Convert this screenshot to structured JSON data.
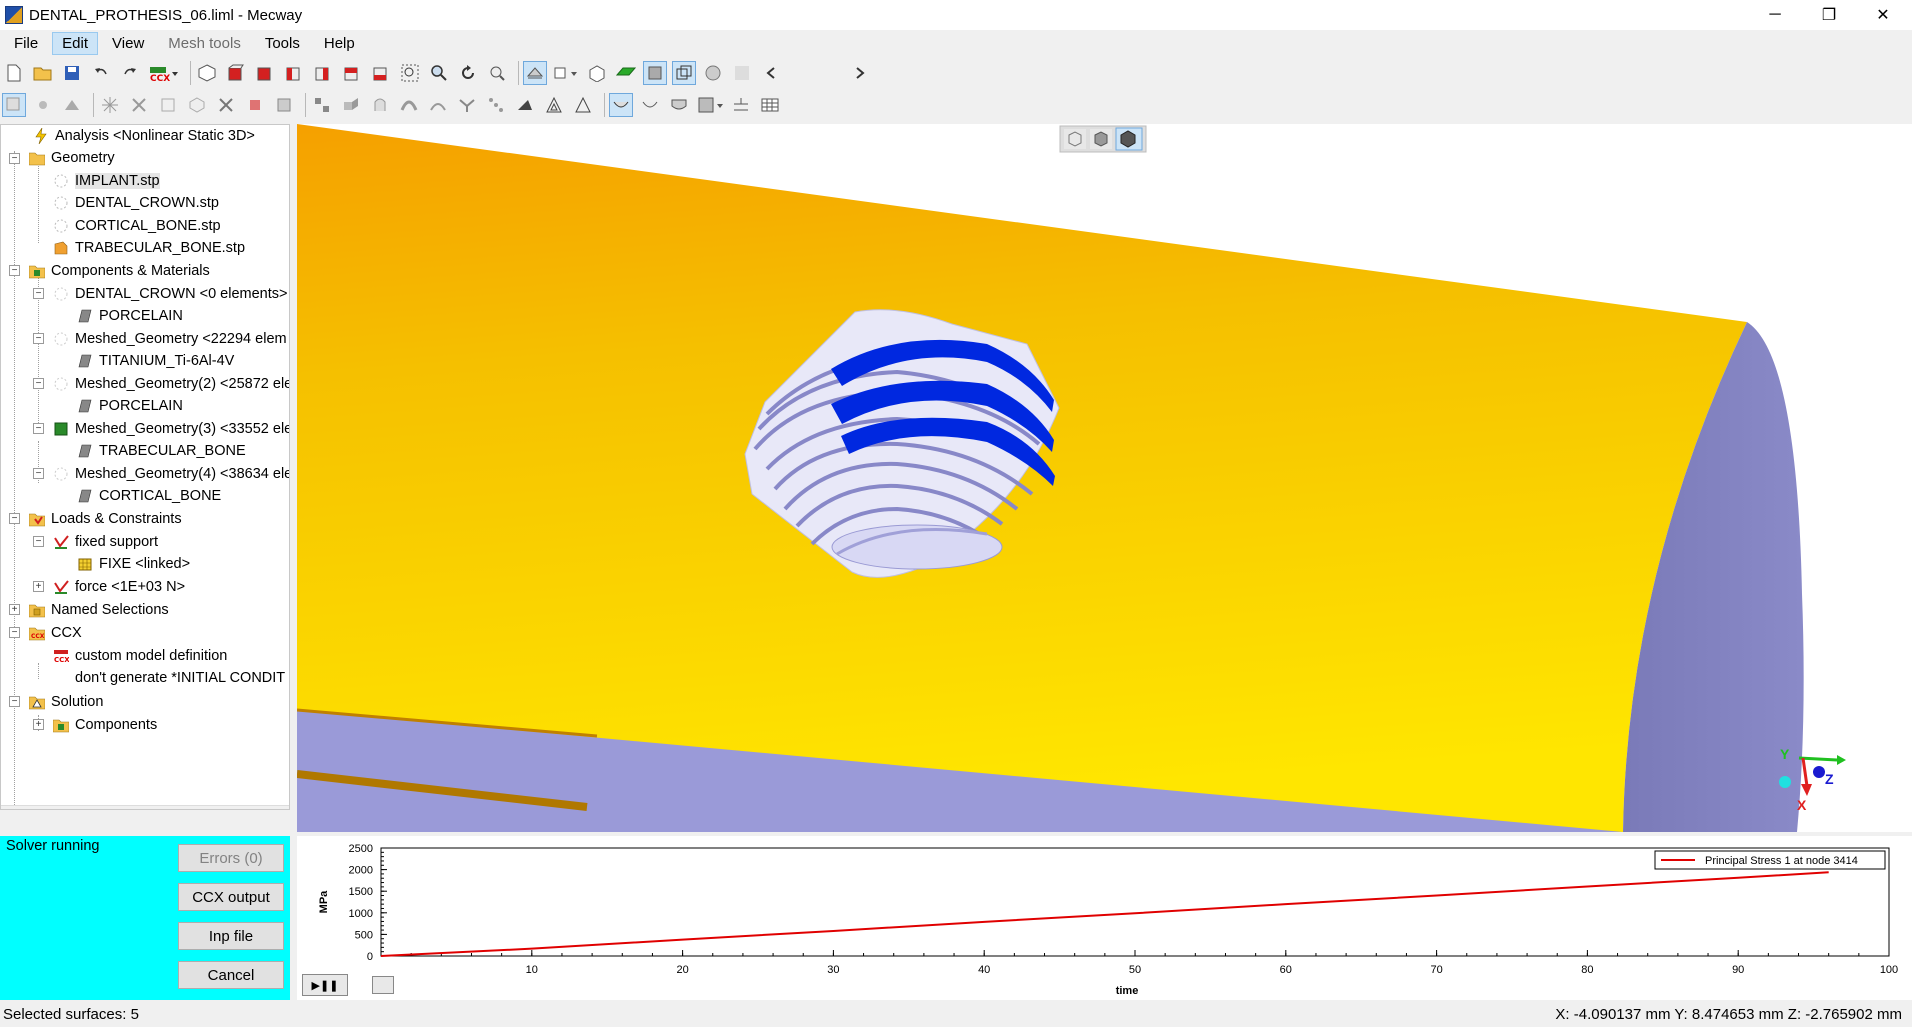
{
  "window": {
    "title": "DENTAL_PROTHESIS_06.liml - Mecway",
    "minimize": "─",
    "restore": "❐",
    "close": "✕"
  },
  "menu": [
    {
      "label": "File",
      "state": "normal"
    },
    {
      "label": "Edit",
      "state": "active"
    },
    {
      "label": "View",
      "state": "normal"
    },
    {
      "label": "Mesh tools",
      "state": "disabled"
    },
    {
      "label": "Tools",
      "state": "normal"
    },
    {
      "label": "Help",
      "state": "normal"
    }
  ],
  "tree": {
    "analysis": "Analysis <Nonlinear Static 3D>",
    "geometry": "Geometry",
    "geo_items": [
      "IMPLANT.stp",
      "DENTAL_CROWN.stp",
      "CORTICAL_BONE.stp",
      "TRABECULAR_BONE.stp"
    ],
    "components": "Components & Materials",
    "comp_items": [
      {
        "name": "DENTAL_CROWN <0 elements>",
        "material": "PORCELAIN"
      },
      {
        "name": "Meshed_Geometry <22294 elem",
        "material": "TITANIUM_Ti-6Al-4V"
      },
      {
        "name": "Meshed_Geometry(2) <25872 ele",
        "material": "PORCELAIN"
      },
      {
        "name": "Meshed_Geometry(3) <33552 ele",
        "material": "TRABECULAR_BONE"
      },
      {
        "name": "Meshed_Geometry(4) <38634 ele",
        "material": "CORTICAL_BONE"
      }
    ],
    "loads": "Loads & Constraints",
    "fixed_support": "fixed support",
    "fixe": "FIXE <linked>",
    "force": "force <1E+03 N>",
    "named_selections": "Named Selections",
    "ccx": "CCX",
    "custom_model": "custom model definition",
    "dont_generate": "don't generate *INITIAL CONDIT",
    "solution": "Solution",
    "solution_components": "Components"
  },
  "solver": {
    "status": "Solver running",
    "errors_button": "Errors (0)",
    "ccx_output_button": "CCX output",
    "inp_file_button": "Inp file",
    "cancel_button": "Cancel",
    "background": "#00ffff"
  },
  "viewport": {
    "axes": {
      "y": "Y",
      "z": "Z",
      "x": "X"
    },
    "colors": {
      "bone_top": "#f5a800",
      "bone_face": "#8080c0",
      "thread": "#0022dd"
    }
  },
  "chart_data": {
    "type": "line",
    "x": [
      0,
      10,
      20,
      30,
      40,
      50,
      60,
      70,
      80,
      90,
      96
    ],
    "series": [
      {
        "name": "Principal Stress 1 at node 3414",
        "values": [
          0,
          170,
          380,
          580,
          790,
          990,
          1200,
          1400,
          1610,
          1810,
          1940
        ],
        "color": "#e00000"
      }
    ],
    "xlabel": "time",
    "ylabel": "MPa",
    "xlim": [
      0,
      100
    ],
    "ylim": [
      0,
      2500
    ],
    "xticks": [
      "10",
      "20",
      "30",
      "40",
      "50",
      "60",
      "70",
      "80",
      "90",
      "100"
    ],
    "xtick_values": [
      10,
      20,
      30,
      40,
      50,
      60,
      70,
      80,
      90,
      100
    ],
    "yticks": [
      "0",
      "500",
      "1000",
      "1500",
      "2000",
      "2500"
    ],
    "ytick_values": [
      0,
      500,
      1000,
      1500,
      2000,
      2500
    ],
    "legend_position": "top-right"
  },
  "statusbar": {
    "left": "Selected surfaces: 5",
    "right": "X: -4.090137 mm Y: 8.474653 mm Z: -2.765902 mm"
  },
  "icons": {
    "toolbar1": [
      "new-file-icon",
      "open-folder-icon",
      "save-icon",
      "undo-icon",
      "redo-icon",
      "ccx-solve-icon",
      "view-iso-icon",
      "view-front-icon",
      "view-back-icon",
      "view-left-icon",
      "view-right-icon",
      "view-top-icon",
      "zoom-box-icon",
      "zoom-icon",
      "rotate-icon",
      "zoom-fit-icon",
      "show-mesh-icon",
      "display-mode-icon",
      "section-icon",
      "surface-icon",
      "solid-icon",
      "wireframe-icon",
      "transparency-icon",
      "scroll-left-icon",
      "scroll-right-icon"
    ],
    "toolbar2": [
      "select-icon",
      "select-node-icon",
      "select-element-icon",
      "select-edge-icon",
      "select-box-icon",
      "select-solid-icon",
      "delete-icon",
      "node-icon",
      "element-icon",
      "mesh-icon",
      "extrude-icon",
      "revolve-icon",
      "sweep-icon",
      "split-icon",
      "merge-icon",
      "refine-icon",
      "tri-icon",
      "outline-icon",
      "smooth-icon",
      "flip-icon",
      "grid-icon",
      "table-icon"
    ]
  }
}
